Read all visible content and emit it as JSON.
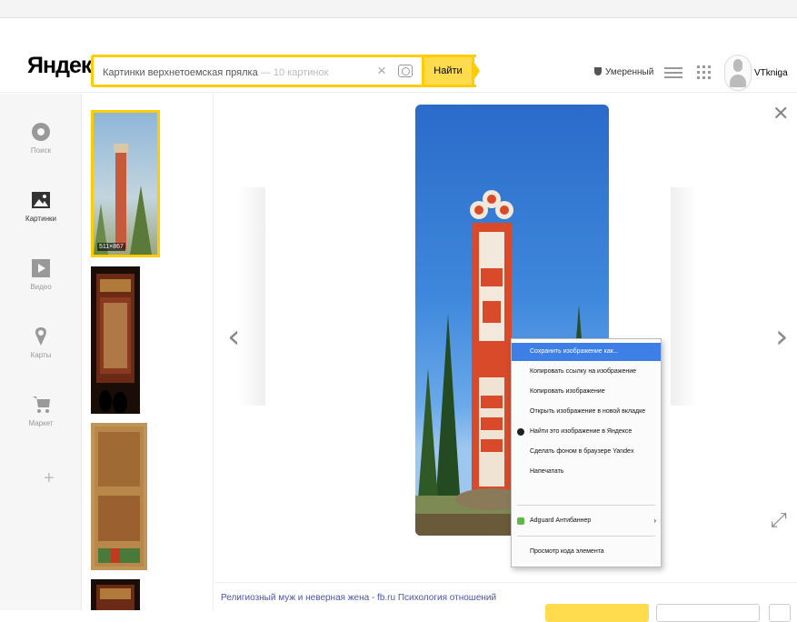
{
  "header": {
    "logo": "Яндекс",
    "search_text": "Картинки   верхнетоемская прялка",
    "search_hint": "— 10 картинок",
    "find_label": "Найти",
    "safe_search": "Умеренный",
    "username": "VTkniga"
  },
  "sidebar": {
    "items": [
      {
        "label": "Поиск"
      },
      {
        "label": "Картинки"
      },
      {
        "label": "Видео"
      },
      {
        "label": "Карты"
      },
      {
        "label": "Маркет"
      }
    ]
  },
  "thumbs": {
    "first_dims": "511×867"
  },
  "context_menu": {
    "items": [
      "Сохранить изображение как...",
      "Копировать ссылку на изображение",
      "Копировать изображение",
      "Открыть изображение в новой вкладке",
      "Найти это изображение в Яндексе",
      "Сделать фоном в браузере Yandex",
      "Напечатать",
      "Adguard Антибаннер",
      "Просмотр кода элемента"
    ]
  },
  "caption": "Религиозный муж и неверная жена - fb.ru Психология отношений",
  "colors": {
    "accent_yellow": "#ffcc00",
    "logo_red": "#e61400",
    "menu_highlight": "#3d7fe6"
  }
}
